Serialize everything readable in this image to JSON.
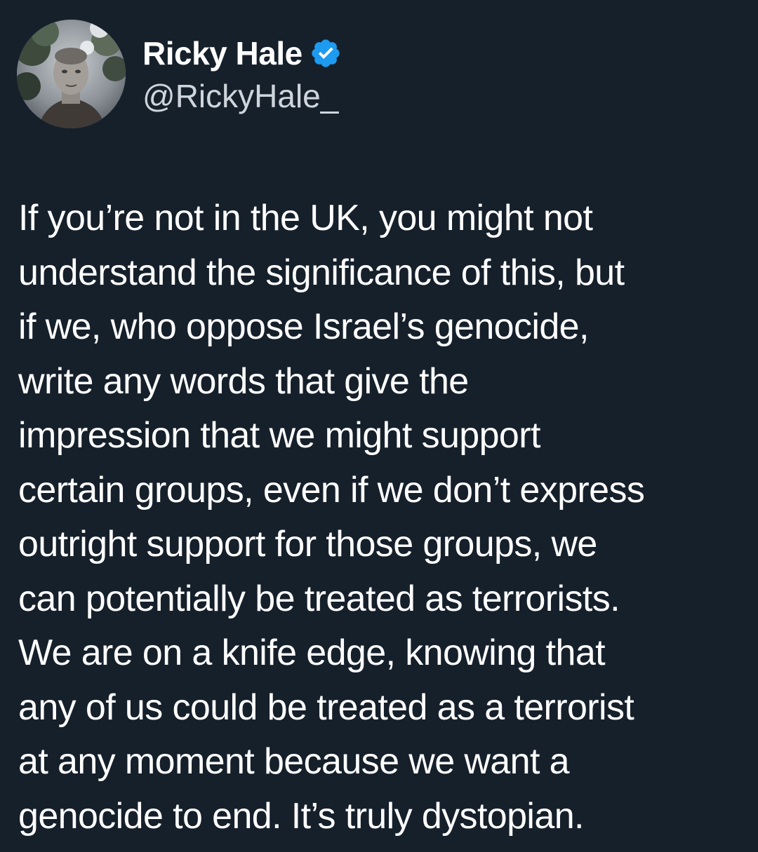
{
  "author": {
    "display_name": "Ricky Hale",
    "handle": "@RickyHale_",
    "verified": true,
    "verified_color": "#1d9bf0"
  },
  "avatar": {
    "icon": "profile-photo"
  },
  "tweet": {
    "lines": [
      "If you’re not in the UK, you might not",
      "understand the significance of this, but",
      "if we, who oppose Israel’s genocide,",
      "write any words that give the",
      "impression that we might support",
      "certain groups, even if we don’t express",
      "outright support for those groups, we",
      "can potentially be treated as terrorists.",
      "We are on a knife edge, knowing that",
      "any of us could be treated as a terrorist",
      "at any moment because we want a",
      "genocide to end. It’s truly dystopian."
    ]
  },
  "colors": {
    "background": "#16202b",
    "text": "#ffffff",
    "handle_text": "#cfd5dc"
  }
}
